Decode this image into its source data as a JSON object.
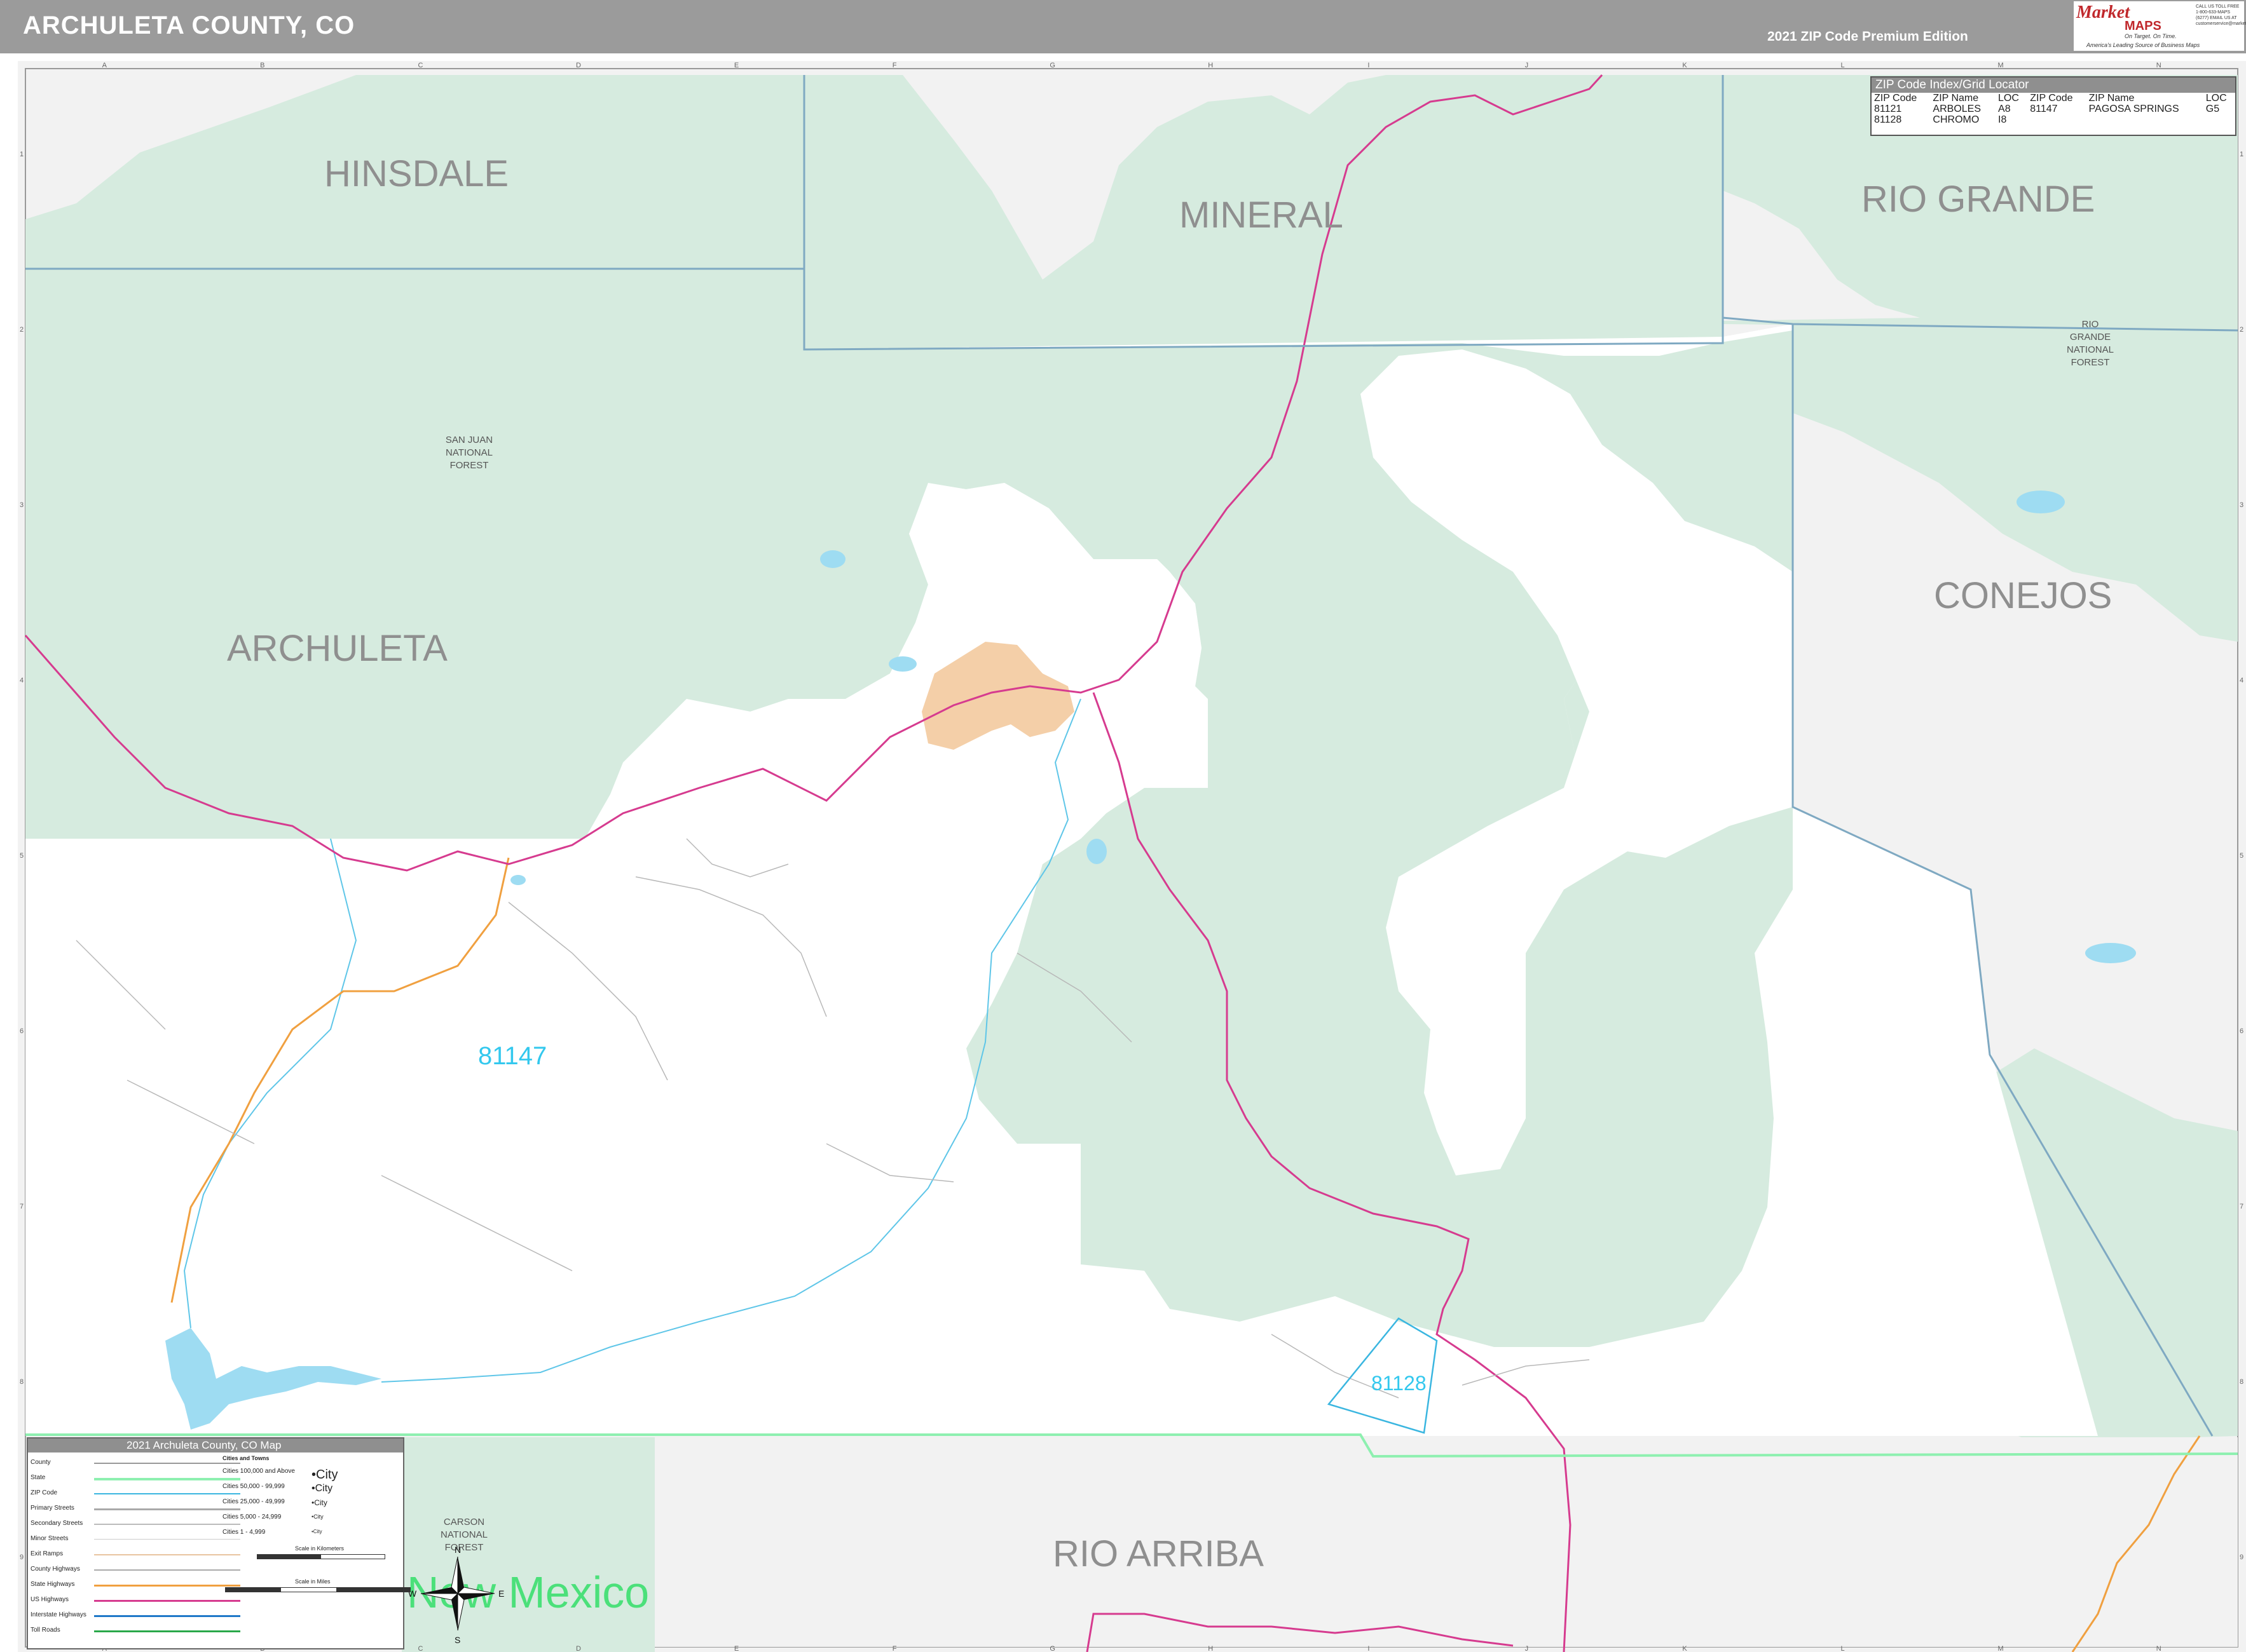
{
  "header": {
    "title": "ARCHULETA COUNTY, CO",
    "edition": "2021 ZIP Code Premium Edition"
  },
  "logo": {
    "brand_top": "Market",
    "brand_bottom": "MAPS",
    "tagline": "On Target. On Time.",
    "tagline2": "America's Leading Source of Business Maps",
    "contact": "CALL US TOLL FREE 1-800-633-MAPS (6277) EMAIL US AT customerservice@marketmaps.com"
  },
  "grid": {
    "columns": [
      "A",
      "B",
      "C",
      "D",
      "E",
      "F",
      "G",
      "H",
      "I",
      "J",
      "K",
      "L",
      "M",
      "N"
    ],
    "rows": [
      "1",
      "2",
      "3",
      "4",
      "5",
      "6",
      "7",
      "8",
      "9"
    ]
  },
  "regions": {
    "hinsdale": "HINSDALE",
    "mineral": "MINERAL",
    "rio_grande": "RIO GRANDE",
    "archuleta": "ARCHULETA",
    "conejos": "CONEJOS",
    "rio_arriba": "RIO ARRIBA",
    "new_mexico": "New Mexico"
  },
  "forests": {
    "san_juan": [
      "SAN JUAN",
      "NATIONAL",
      "FOREST"
    ],
    "rio_grande": [
      "RIO",
      "GRANDE",
      "NATIONAL",
      "FOREST"
    ],
    "carson": [
      "CARSON",
      "NATIONAL",
      "FOREST"
    ]
  },
  "zips": {
    "z81147": "81147",
    "z81128": "81128"
  },
  "zip_index": {
    "title": "ZIP Code Index/Grid Locator",
    "headers": [
      "ZIP Code",
      "ZIP Name",
      "LOC",
      "ZIP Code",
      "ZIP Name",
      "LOC"
    ],
    "rows": [
      [
        "81121",
        "ARBOLES",
        "A8",
        "81147",
        "PAGOSA SPRINGS",
        "G5"
      ],
      [
        "81128",
        "CHROMO",
        "I8",
        "",
        "",
        ""
      ]
    ]
  },
  "legend": {
    "title": "2021 Archuleta County, CO Map",
    "items": [
      "County",
      "State",
      "ZIP Code",
      "Primary Streets",
      "Secondary Streets",
      "Minor Streets",
      "Exit Ramps",
      "County Highways",
      "State Highways",
      "US Highways",
      "Interstate Highways",
      "Toll Roads"
    ],
    "cities_title": "Cities and Towns",
    "city_sizes": [
      [
        "Cities 100,000 and Above",
        "•City"
      ],
      [
        "Cities 50,000 - 99,999",
        "•City"
      ],
      [
        "Cities 25,000 - 49,999",
        "•City"
      ],
      [
        "Cities 5,000 - 24,999",
        "•City"
      ],
      [
        "Cities 1 - 4,999",
        "•City"
      ]
    ],
    "scale_km": "Scale in Kilometers",
    "scale_mi": "Scale in Miles"
  },
  "compass": {
    "n": "N",
    "s": "S",
    "e": "E",
    "w": "W"
  },
  "colors": {
    "forest": "#d6ebdf",
    "private": "#ffffff",
    "outside": "#f2f2f2",
    "county_line": "#7fa9c2",
    "state_line": "#8ef0b0",
    "us_hwy": "#d63b8f",
    "state_hwy": "#f0a040",
    "zip_line": "#3ab6e0",
    "zip_text": "#33c8ee",
    "urban": "#f4cfa8",
    "water": "#9edcf2"
  }
}
